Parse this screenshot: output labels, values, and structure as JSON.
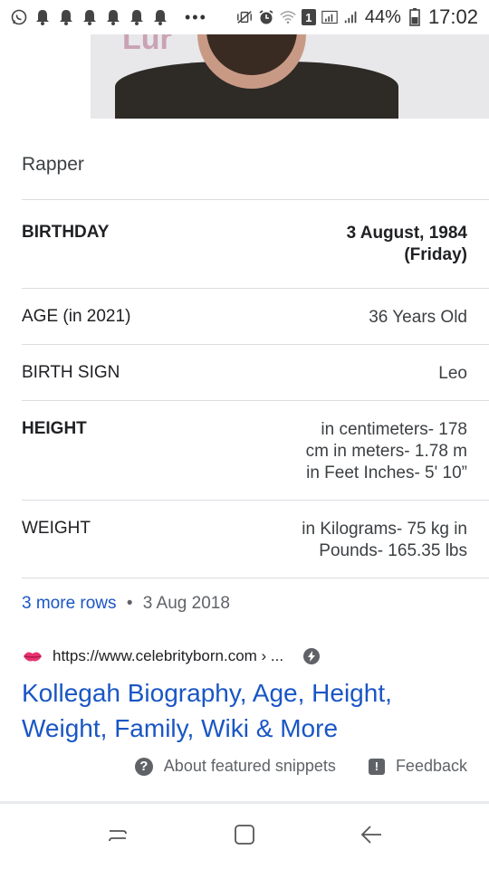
{
  "status_bar": {
    "battery": "44%",
    "time": "17:02",
    "sim_badge": "1",
    "more": "•••"
  },
  "hero": {
    "partial_text": "Lur"
  },
  "card": {
    "title": "Rapper",
    "rows": [
      {
        "label": "BIRTHDAY",
        "value": "3 August, 1984\n(Friday)"
      },
      {
        "label": "AGE (in 2021)",
        "value": "36 Years Old"
      },
      {
        "label": "BIRTH SIGN",
        "value": "Leo"
      },
      {
        "label": "HEIGHT",
        "value": "in centimeters- 178\ncm in meters- 1.78 m\nin Feet Inches- 5' 10”"
      },
      {
        "label": "WEIGHT",
        "value": "in Kilograms- 75 kg in\nPounds- 165.35 lbs"
      }
    ],
    "more_rows": "3 more rows",
    "date": "3 Aug 2018",
    "source_url": "https://www.celebrityborn.com › ...",
    "result_title": "Kollegah Biography, Age, Height, Weight, Family, Wiki & More",
    "about_snippets": "About featured snippets",
    "feedback": "Feedback"
  },
  "colors": {
    "link": "#1a56c4",
    "secondary_text": "#5f6368",
    "divider": "#dadce0"
  },
  "icons": {
    "status_left": [
      "whatsapp-icon",
      "bell-icon",
      "bell-icon",
      "bell-icon",
      "bell-icon",
      "bell-icon",
      "bell-icon"
    ],
    "status_right": [
      "mute-vibrate-icon",
      "alarm-icon",
      "wifi-icon",
      "sim-1-icon",
      "signal-icon",
      "signal-icon",
      "battery-icon"
    ],
    "nav": [
      "recent-apps-icon",
      "home-icon",
      "back-icon"
    ]
  }
}
